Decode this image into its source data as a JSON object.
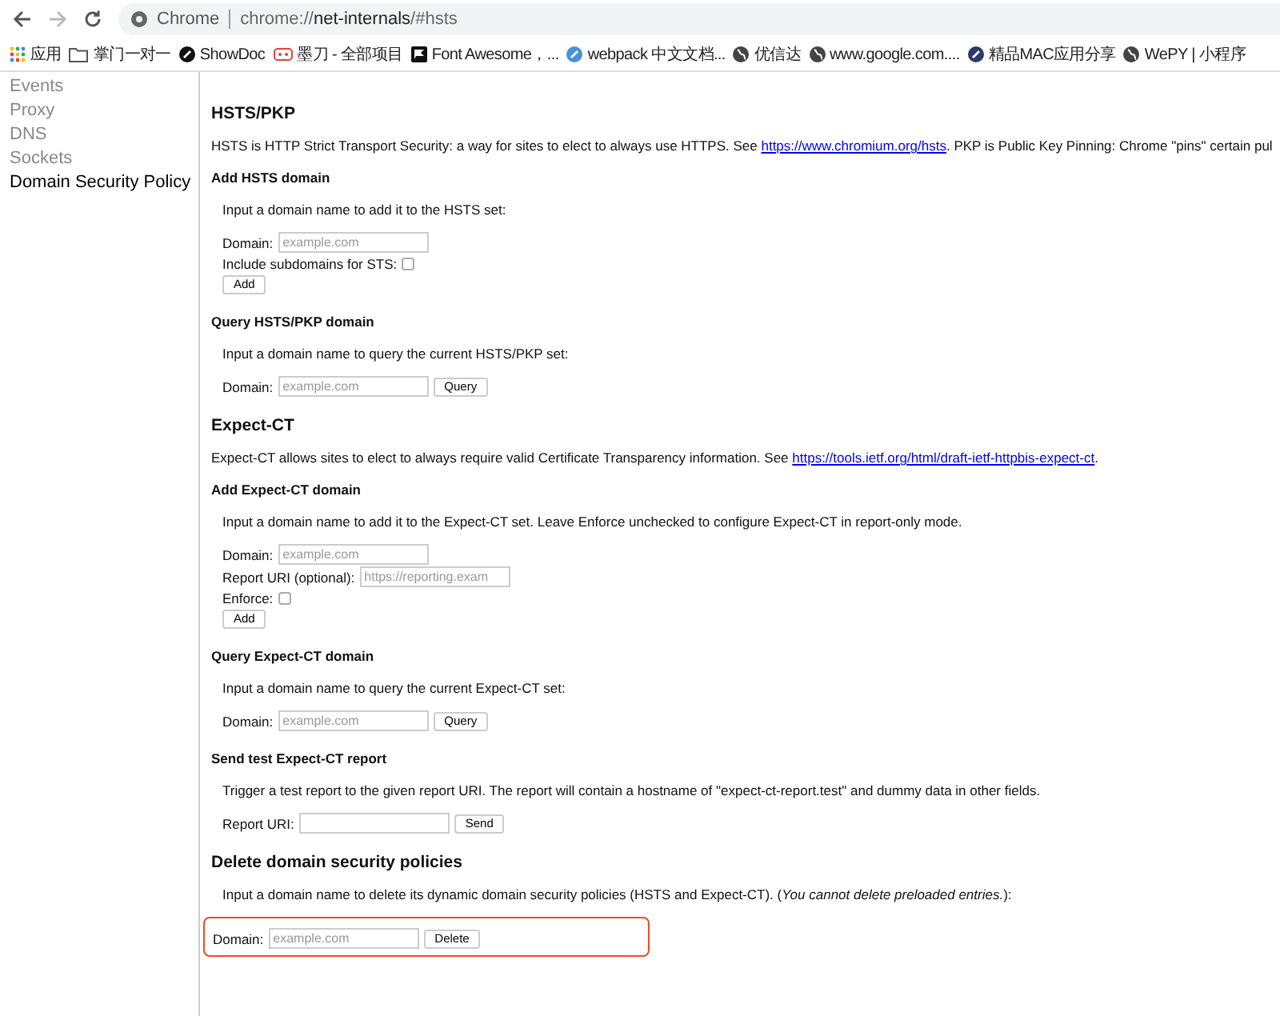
{
  "toolbar": {
    "back_disabled": false,
    "forward_disabled": true,
    "omnibox": {
      "label": "Chrome",
      "scheme": "chrome://",
      "host": "net-internals",
      "path": "/#hsts"
    }
  },
  "bookmarks": [
    {
      "label": "应用"
    },
    {
      "label": "掌门一对一"
    },
    {
      "label": "ShowDoc"
    },
    {
      "label": "墨刀 - 全部项目"
    },
    {
      "label": "Font Awesome，..."
    },
    {
      "label": "webpack 中文文档..."
    },
    {
      "label": "优信达"
    },
    {
      "label": "www.google.com...."
    },
    {
      "label": "精品MAC应用分享"
    },
    {
      "label": "WePY | 小程序"
    }
  ],
  "sidebar": {
    "items": [
      {
        "label": "Events",
        "selected": false
      },
      {
        "label": "Proxy",
        "selected": false
      },
      {
        "label": "DNS",
        "selected": false
      },
      {
        "label": "Sockets",
        "selected": false
      },
      {
        "label": "Domain Security Policy",
        "selected": true
      }
    ]
  },
  "blocks": [
    {
      "kind": "heading",
      "text": "HSTS/PKP"
    },
    {
      "kind": "paragraph",
      "text": "HSTS is HTTP Strict Transport Security: a way for sites to elect to always use HTTPS. See ",
      "link": "https://www.chromium.org/hsts",
      "after": ". PKP is Public Key Pinning: Chrome \"pins\" certain pul"
    },
    {
      "kind": "subheading",
      "text": "Add HSTS domain"
    },
    {
      "kind": "note",
      "text": "Input a domain name to add it to the HSTS set:"
    },
    {
      "kind": "form",
      "rows": [
        {
          "items": [
            {
              "kind": "label",
              "text": "Domain:"
            },
            {
              "kind": "input",
              "placeholder": "example.com"
            }
          ]
        },
        {
          "items": [
            {
              "kind": "label",
              "text": "Include subdomains for STS:"
            },
            {
              "kind": "checkbox",
              "checked": false
            }
          ]
        },
        {
          "items": [
            {
              "kind": "button",
              "text": "Add"
            }
          ]
        }
      ]
    },
    {
      "kind": "subheading",
      "text": "Query HSTS/PKP domain"
    },
    {
      "kind": "note",
      "text": "Input a domain name to query the current HSTS/PKP set:"
    },
    {
      "kind": "form",
      "rows": [
        {
          "items": [
            {
              "kind": "label",
              "text": "Domain:"
            },
            {
              "kind": "input",
              "placeholder": "example.com"
            },
            {
              "kind": "button",
              "text": "Query"
            }
          ]
        }
      ]
    },
    {
      "kind": "heading",
      "text": "Expect-CT"
    },
    {
      "kind": "paragraph",
      "text": "Expect-CT allows sites to elect to always require valid Certificate Transparency information. See ",
      "link": "https://tools.ietf.org/html/draft-ietf-httpbis-expect-ct",
      "after": "."
    },
    {
      "kind": "subheading",
      "text": "Add Expect-CT domain"
    },
    {
      "kind": "note",
      "text": "Input a domain name to add it to the Expect-CT set. Leave Enforce unchecked to configure Expect-CT in report-only mode."
    },
    {
      "kind": "form",
      "rows": [
        {
          "items": [
            {
              "kind": "label",
              "text": "Domain:"
            },
            {
              "kind": "input",
              "placeholder": "example.com"
            }
          ]
        },
        {
          "items": [
            {
              "kind": "label",
              "text": "Report URI (optional):"
            },
            {
              "kind": "input",
              "placeholder": "https://reporting.exam"
            }
          ]
        },
        {
          "items": [
            {
              "kind": "label",
              "text": "Enforce:"
            },
            {
              "kind": "checkbox",
              "checked": false
            }
          ]
        },
        {
          "items": [
            {
              "kind": "button",
              "text": "Add"
            }
          ]
        }
      ]
    },
    {
      "kind": "subheading",
      "text": "Query Expect-CT domain"
    },
    {
      "kind": "note",
      "text": "Input a domain name to query the current Expect-CT set:"
    },
    {
      "kind": "form",
      "rows": [
        {
          "items": [
            {
              "kind": "label",
              "text": "Domain:"
            },
            {
              "kind": "input",
              "placeholder": "example.com"
            },
            {
              "kind": "button",
              "text": "Query"
            }
          ]
        }
      ]
    },
    {
      "kind": "subheading",
      "text": "Send test Expect-CT report"
    },
    {
      "kind": "note",
      "text": "Trigger a test report to the given report URI. The report will contain a hostname of \"expect-ct-report.test\" and dummy data in other fields."
    },
    {
      "kind": "form",
      "rows": [
        {
          "items": [
            {
              "kind": "label",
              "text": "Report URI:"
            },
            {
              "kind": "input"
            },
            {
              "kind": "button",
              "text": "Send"
            }
          ]
        }
      ]
    },
    {
      "kind": "heading",
      "text": "Delete domain security policies"
    },
    {
      "kind": "note",
      "text": "Input a domain name to delete its dynamic domain security policies (HSTS and Expect-CT). (*You cannot delete preloaded entries.*):"
    },
    {
      "kind": "form",
      "highlighted": true,
      "rows": [
        {
          "items": [
            {
              "kind": "label",
              "text": "Domain:"
            },
            {
              "kind": "input",
              "placeholder": "example.com"
            },
            {
              "kind": "button",
              "text": "Delete"
            }
          ]
        }
      ]
    }
  ]
}
